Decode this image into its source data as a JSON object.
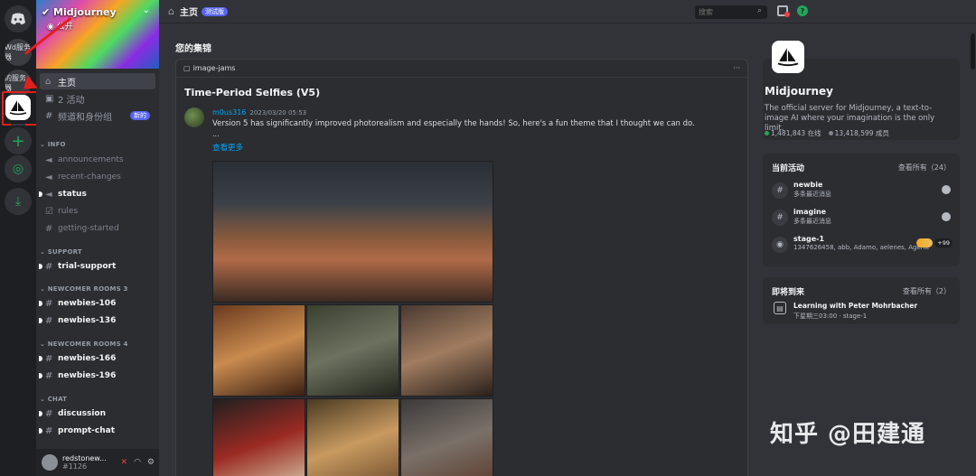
{
  "rail": {
    "wd_label": "Wd服务器",
    "mine_label": "的服务器",
    "add_symbol": "+",
    "explore_symbol": "◎",
    "download_symbol": "⤓"
  },
  "server": {
    "name": "Midjourney",
    "visibility": "公开",
    "description": "The official server for Midjourney, a text-to-image AI where your imagination is the only limit.",
    "online": "1,481,843 在线",
    "members": "13,418,599 成员"
  },
  "sidebar": {
    "nav": [
      {
        "label": "主页"
      },
      {
        "label": "2 活动"
      },
      {
        "label": "频道和身份组",
        "badge": "新的"
      }
    ],
    "categories": {
      "info": "INFO",
      "support": "SUPPORT",
      "newcomer3": "NEWCOMER ROOMS 3",
      "newcomer4": "NEWCOMER ROOMS 4",
      "chat": "CHAT"
    },
    "channels": {
      "announcements": "announcements",
      "recent_changes": "recent-changes",
      "status": "status",
      "rules": "rules",
      "getting_started": "getting-started",
      "trial_support": "trial-support",
      "newbies_106": "newbies-106",
      "newbies_136": "newbies-136",
      "newbies_166": "newbies-166",
      "newbies_196": "newbies-196",
      "discussion": "discussion",
      "prompt_chat": "prompt-chat"
    },
    "user": {
      "name": "redstonew...",
      "tag": "#1126"
    }
  },
  "topbar": {
    "title": "主页",
    "badge": "测试版",
    "search_placeholder": "搜索"
  },
  "main": {
    "section_title": "您的集锦",
    "post": {
      "channel": "image-jams",
      "more": "···",
      "title": "Time-Period Selfies (V5)",
      "author": "m0us316",
      "time": "2023/03/20 05:53",
      "text": "Version 5 has significantly improved photorealism and especially the hands! So, here's a fun theme that I thought we can do.",
      "ellipsis": "...",
      "see_more": "查看更多"
    }
  },
  "right": {
    "activity": {
      "title": "当前活动",
      "view_all": "查看所有（24）",
      "items": [
        {
          "name": "newbie",
          "sub": "多条最近消息"
        },
        {
          "name": "imagine",
          "sub": "多条最近消息"
        },
        {
          "name": "stage-1",
          "sub": "1347626458, abb, Adamo, aelenes, Agenia™, Agil...",
          "plus": "+99"
        }
      ]
    },
    "upcoming": {
      "title": "即将到来",
      "view_all": "查看所有（2）",
      "event_name": "Learning with Peter Mohrbacher",
      "event_sub": "下星期三03:00 · stage-1"
    }
  },
  "watermark": "知乎 @田建通",
  "colors": {
    "accent": "#5865f2",
    "online": "#23a559",
    "link": "#00a8fc",
    "highlight_box": "#e0201c"
  }
}
